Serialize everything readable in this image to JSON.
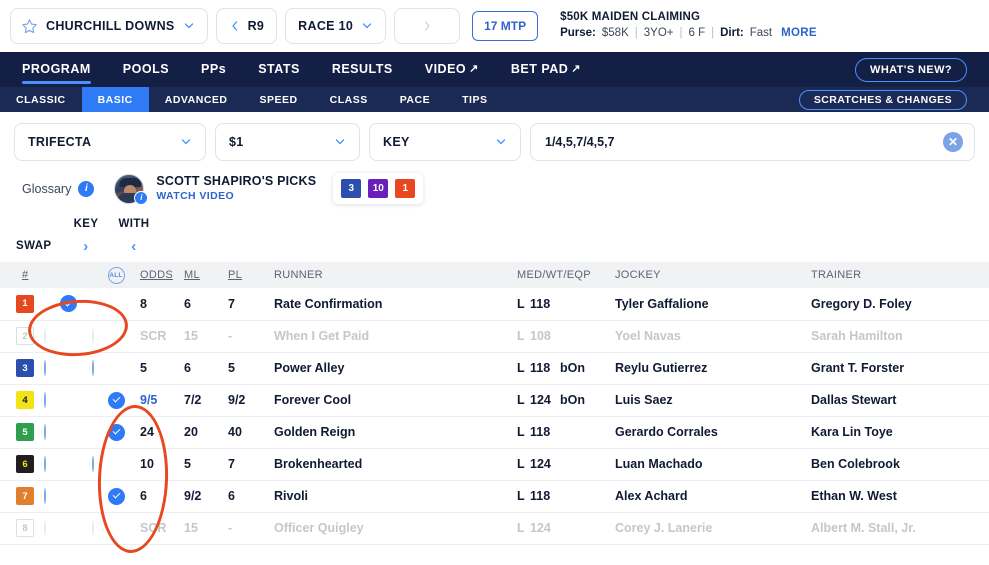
{
  "topbar": {
    "track": "CHURCHILL DOWNS",
    "prev_race": "R9",
    "current_race": "RACE 10",
    "mtp": "17 MTP",
    "race_title": "$50K MAIDEN CLAIMING",
    "purse_label": "Purse:",
    "purse_value": "$58K",
    "age": "3YO+",
    "distance": "6 F",
    "surface_label": "Dirt:",
    "surface_value": "Fast",
    "more": "MORE",
    "star_icon": "star-outline-icon",
    "chevron_icon": "chevron-down-icon",
    "prev_icon": "chevron-left-icon",
    "next_icon": "chevron-right-icon"
  },
  "nav_primary": {
    "items": [
      {
        "label": "PROGRAM",
        "active": true,
        "external": false
      },
      {
        "label": "POOLS",
        "active": false,
        "external": false
      },
      {
        "label": "PPs",
        "active": false,
        "external": false
      },
      {
        "label": "STATS",
        "active": false,
        "external": false
      },
      {
        "label": "RESULTS",
        "active": false,
        "external": false
      },
      {
        "label": "VIDEO",
        "active": false,
        "external": true
      },
      {
        "label": "BET PAD",
        "active": false,
        "external": true
      }
    ],
    "whats_new": "WHAT'S NEW?"
  },
  "nav_secondary": {
    "items": [
      {
        "label": "CLASSIC",
        "active": false
      },
      {
        "label": "BASIC",
        "active": true
      },
      {
        "label": "ADVANCED",
        "active": false
      },
      {
        "label": "SPEED",
        "active": false
      },
      {
        "label": "CLASS",
        "active": false
      },
      {
        "label": "PACE",
        "active": false
      },
      {
        "label": "TIPS",
        "active": false
      }
    ],
    "scratches": "SCRATCHES & CHANGES"
  },
  "bet_controls": {
    "bet_type": "TRIFECTA",
    "bet_amount": "$1",
    "bet_mode": "KEY",
    "selection": "1/4,5,7/4,5,7",
    "clear_icon": "close-circle-icon"
  },
  "picks": {
    "glossary_label": "Glossary",
    "info_icon": "info-icon",
    "handicapper": "SCOTT SHAPIRO'S PICKS",
    "watch_video": "WATCH VIDEO",
    "badges": [
      {
        "num": "3",
        "color": "#2c4fae"
      },
      {
        "num": "10",
        "color": "#6a1fb8"
      },
      {
        "num": "1",
        "color": "#e8481f"
      }
    ]
  },
  "swap": {
    "swap_label": "SWAP",
    "key_label": "KEY",
    "with_label": "WITH",
    "key_arrow_icon": "chevron-right-icon",
    "with_arrow_icon": "chevron-left-icon"
  },
  "table": {
    "headers": {
      "num": "#",
      "all": "ALL",
      "odds": "ODDS",
      "ml": "ML",
      "pl": "PL",
      "runner": "RUNNER",
      "med": "MED/WT/EQP",
      "jockey": "JOCKEY",
      "trainer": "TRAINER"
    },
    "rows": [
      {
        "num": "1",
        "badge_color": "#e8481f",
        "badge_text": "#ffffff",
        "key": "checked",
        "with": "none",
        "odds": "8",
        "odds_color": "",
        "ml": "6",
        "pl": "7",
        "pl_green": true,
        "runner": "Rate Confirmation",
        "med": "L",
        "wt": "118",
        "eqp": "",
        "jockey": "Tyler Gaffalione",
        "trainer": "Gregory D. Foley",
        "scratched": false
      },
      {
        "num": "2",
        "badge_color": "#ffffff",
        "badge_text": "#c3c7ce",
        "key": "ghost",
        "with": "ghost",
        "odds": "SCR",
        "odds_color": "",
        "ml": "15",
        "pl": "-",
        "pl_green": false,
        "runner": "When I Get Paid",
        "med": "L",
        "wt": "108",
        "eqp": "",
        "jockey": "Yoel Navas",
        "trainer": "Sarah Hamilton",
        "scratched": true
      },
      {
        "num": "3",
        "badge_color": "#2c4fae",
        "badge_text": "#ffffff",
        "key": "empty",
        "with": "empty",
        "odds": "5",
        "odds_color": "",
        "ml": "6",
        "pl": "5",
        "pl_green": false,
        "runner": "Power Alley",
        "med": "L",
        "wt": "118",
        "eqp": "bOn",
        "jockey": "Reylu Gutierrez",
        "trainer": "Grant T. Forster",
        "scratched": false
      },
      {
        "num": "4",
        "badge_color": "#f2e218",
        "badge_text": "#101b33",
        "key": "empty",
        "with": "checked",
        "odds": "9/5",
        "odds_color": "#2f63cc",
        "ml": "7/2",
        "pl": "9/2",
        "pl_green": false,
        "runner": "Forever Cool",
        "med": "L",
        "wt": "124",
        "eqp": "bOn",
        "jockey": "Luis Saez",
        "trainer": "Dallas Stewart",
        "scratched": false
      },
      {
        "num": "5",
        "badge_color": "#2f9e4f",
        "badge_text": "#ffffff",
        "key": "empty",
        "with": "checked",
        "odds": "24",
        "odds_color": "",
        "ml": "20",
        "pl": "40",
        "pl_green": false,
        "runner": "Golden Reign",
        "med": "L",
        "wt": "118",
        "eqp": "",
        "jockey": "Gerardo Corrales",
        "trainer": "Kara Lin Toye",
        "scratched": false
      },
      {
        "num": "6",
        "badge_color": "#1f1f1f",
        "badge_text": "#f2e218",
        "key": "empty",
        "with": "empty",
        "odds": "10",
        "odds_color": "",
        "ml": "5",
        "pl": "7",
        "pl_green": true,
        "runner": "Brokenhearted",
        "med": "L",
        "wt": "124",
        "eqp": "",
        "jockey": "Luan Machado",
        "trainer": "Ben Colebrook",
        "scratched": false
      },
      {
        "num": "7",
        "badge_color": "#e0802f",
        "badge_text": "#ffffff",
        "key": "empty",
        "with": "checked",
        "odds": "6",
        "odds_color": "",
        "ml": "9/2",
        "pl": "6",
        "pl_green": false,
        "runner": "Rivoli",
        "med": "L",
        "wt": "118",
        "eqp": "",
        "jockey": "Alex Achard",
        "trainer": "Ethan W. West",
        "scratched": false
      },
      {
        "num": "8",
        "badge_color": "#fbe2e6",
        "badge_text": "#d6aab2",
        "key": "ghost",
        "with": "ghost",
        "odds": "SCR",
        "odds_color": "",
        "ml": "15",
        "pl": "-",
        "pl_green": false,
        "runner": "Officer Quigley",
        "med": "L",
        "wt": "124",
        "eqp": "",
        "jockey": "Corey J. Lanerie",
        "trainer": "Albert M. Stall, Jr.",
        "scratched": true
      }
    ]
  },
  "annotations": {
    "key_circle": "highlight-oval-key-column",
    "with_circle": "highlight-oval-with-column",
    "color": "#e8481f"
  }
}
